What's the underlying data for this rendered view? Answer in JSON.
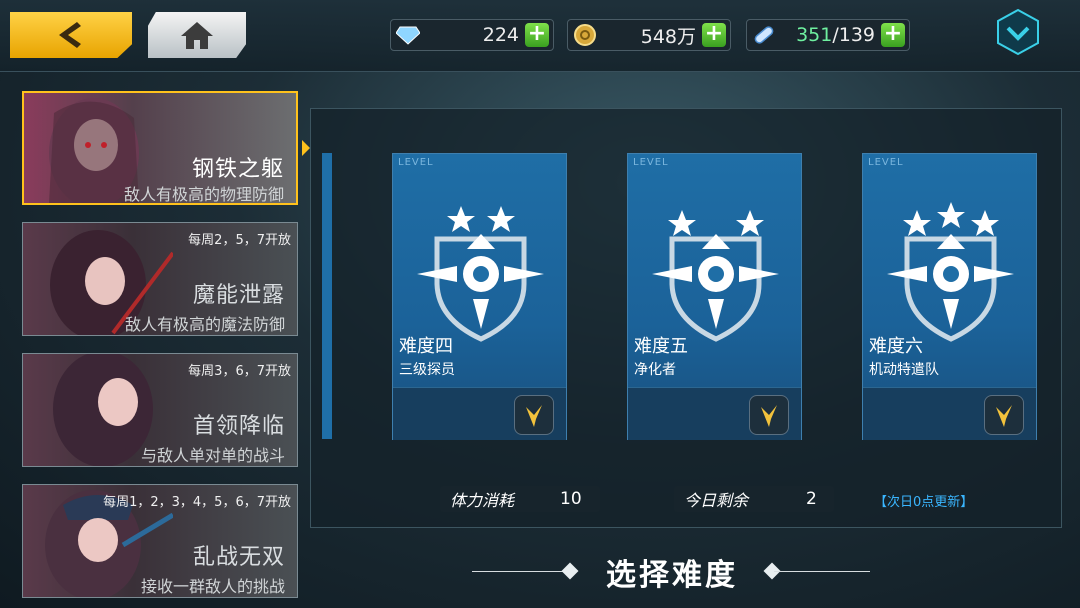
{
  "resources": {
    "gems": {
      "value": "224",
      "icon": "gem-icon"
    },
    "coins": {
      "value": "548万",
      "icon": "coin-icon"
    },
    "stamina": {
      "current": "351",
      "max": "/139",
      "icon": "stamina-pill-icon"
    }
  },
  "modes": [
    {
      "title": "钢铁之躯",
      "desc": "敌人有极高的物理防御",
      "schedule": "",
      "selected": true
    },
    {
      "title": "魔能泄露",
      "desc": "敌人有极高的魔法防御",
      "schedule": "每周2，5，7开放",
      "selected": false
    },
    {
      "title": "首领降临",
      "desc": "与敌人单对单的战斗",
      "schedule": "每周3，6，7开放",
      "selected": false
    },
    {
      "title": "乱战无双",
      "desc": "接收一群敌人的挑战",
      "schedule": "每周1，2，3，4，5，6，7开放",
      "selected": false
    }
  ],
  "levels": [
    {
      "tag": "LEVEL",
      "name": "难度四",
      "sub": "三级探员",
      "stars": 2
    },
    {
      "tag": "LEVEL",
      "name": "难度五",
      "sub": "净化者",
      "stars": 2
    },
    {
      "tag": "LEVEL",
      "name": "难度六",
      "sub": "机动特遣队",
      "stars": 3
    }
  ],
  "stats": {
    "stamina_cost_label": "体力消耗",
    "stamina_cost_value": "10",
    "remaining_label": "今日剩余",
    "remaining_value": "2",
    "refresh_note": "【次日0点更新】"
  },
  "footer": {
    "title": "选择难度"
  },
  "colors": {
    "accent": "#ffc21c",
    "card_blue": "#1f6ea6",
    "plus_green": "#3aa020",
    "stamina_green": "#6ff0a0",
    "refresh_blue": "#3ab6ff"
  }
}
